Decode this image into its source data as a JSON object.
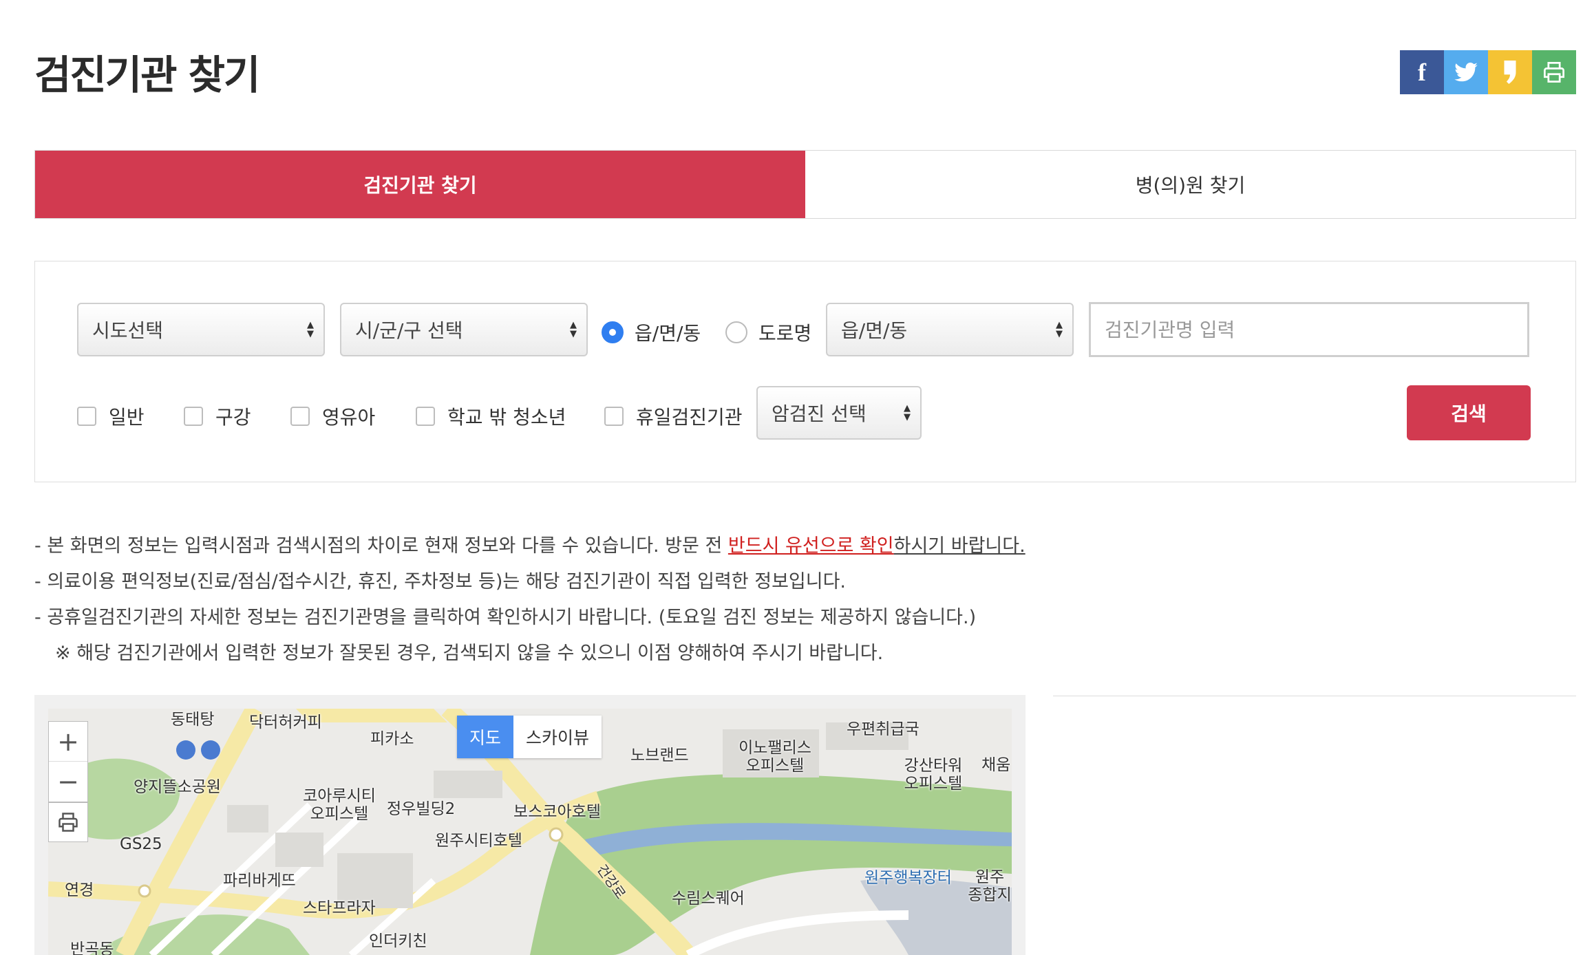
{
  "page": {
    "title": "검진기관 찾기"
  },
  "share": {
    "facebook": "f",
    "twitter": "t",
    "kakaostory": "ks",
    "print": "print"
  },
  "tabs": [
    {
      "label": "검진기관 찾기",
      "active": true
    },
    {
      "label": "병(의)원 찾기",
      "active": false
    }
  ],
  "search": {
    "sido_select": "시도선택",
    "sigungu_select": "시/군/구 선택",
    "radio_options": [
      {
        "label": "읍/면/동",
        "checked": true
      },
      {
        "label": "도로명",
        "checked": false
      }
    ],
    "dong_select": "읍/면/동",
    "name_placeholder": "검진기관명 입력",
    "checkboxes": [
      "일반",
      "구강",
      "영유아",
      "학교 밖 청소년",
      "휴일검진기관"
    ],
    "cancer_select": "암검진 선택",
    "search_button": "검색"
  },
  "notices": {
    "line1_pre": "- 본 화면의 정보는 입력시점과 검색시점의 차이로 현재 정보와 다를 수 있습니다.  방문 전 ",
    "line1_highlight": "반드시 유선으로 확인",
    "line1_post": "하시기 바랍니다.",
    "line2": "- 의료이용 편익정보(진료/점심/접수시간, 휴진, 주차정보 등)는 해당 검진기관이 직접 입력한 정보입니다.",
    "line3": "- 공휴일검진기관의 자세한 정보는 검진기관명을 클릭하여 확인하시기 바랍니다. (토요일 검진 정보는 제공하지 않습니다.)",
    "line4": "※ 해당 검진기관에서 입력한 정보가 잘못된 경우, 검색되지 않을 수 있으니 이점 양해하여 주시기 바랍니다."
  },
  "map": {
    "zoom_in": "+",
    "zoom_out": "−",
    "type_map": "지도",
    "type_sky": "스카이뷰",
    "labels": [
      "동태탕",
      "닥터허커피",
      "피카소",
      "양지뜰소공원",
      "GS25",
      "연경",
      "파리바게뜨",
      "코아루시티 오피스텔",
      "정우빌딩2",
      "원주시티호텔",
      "보스코아호텔",
      "스타프라자",
      "인더키친",
      "반곡동",
      "노브랜드",
      "이노팰리스 오피스텔",
      "우편취급국",
      "강산타워 오피스텔",
      "채움",
      "원주행복장터",
      "원주 종합지",
      "수림스퀘어",
      "건강로"
    ]
  }
}
